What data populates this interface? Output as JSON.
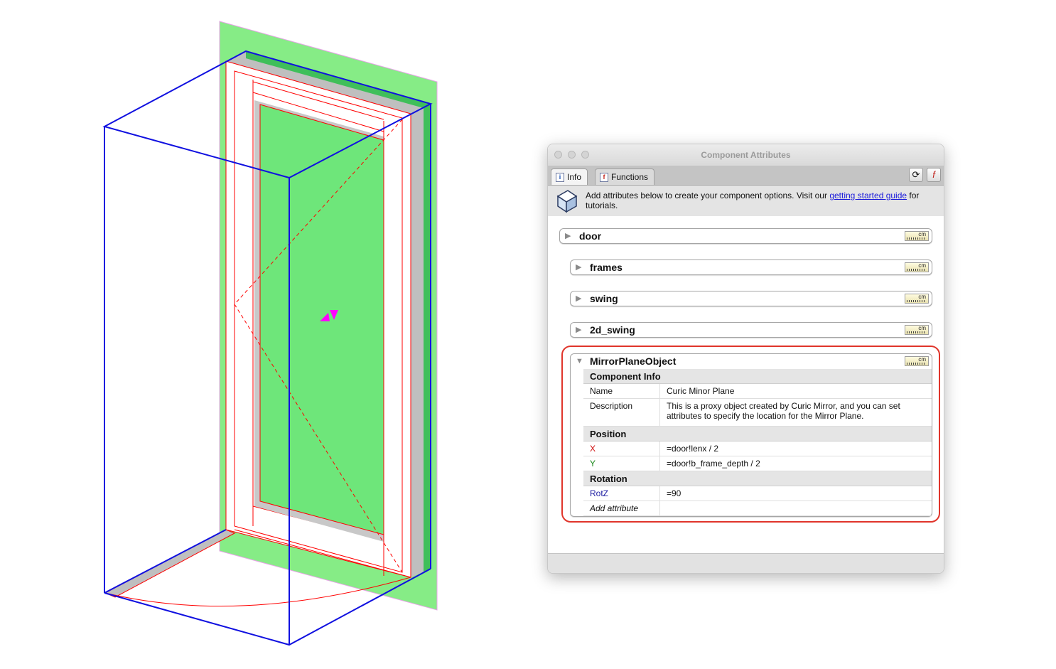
{
  "window": {
    "title": "Component Attributes",
    "tabs": [
      {
        "label": "Info",
        "icon": "info-icon",
        "active": true
      },
      {
        "label": "Functions",
        "icon": "functions-icon",
        "active": false
      }
    ],
    "toolbar": {
      "refresh_icon": "refresh-icon",
      "toggle_formula_icon": "toggle-formula-icon"
    },
    "info": {
      "text_before": "Add attributes below to create your component options. Visit our ",
      "link": "getting started guide",
      "text_after": " for tutorials."
    }
  },
  "components": [
    {
      "name": "door",
      "unit": "cm",
      "expanded": false
    },
    {
      "name": "frames",
      "unit": "cm",
      "expanded": false
    },
    {
      "name": "swing",
      "unit": "cm",
      "expanded": false
    },
    {
      "name": "2d_swing",
      "unit": "cm",
      "expanded": false
    },
    {
      "name": "MirrorPlaneObject",
      "unit": "cm",
      "expanded": true
    }
  ],
  "attributes": {
    "component_info": {
      "header": "Component Info",
      "name_label": "Name",
      "name_value": "Curic Minor Plane",
      "description_label": "Description",
      "description_value": "This is a proxy object created by Curic Mirror, and you can set attributes to specify the location for the Mirror Plane."
    },
    "position": {
      "header": "Position",
      "x_label": "X",
      "x_value": "=door!lenx / 2",
      "y_label": "Y",
      "y_value": "=door!b_frame_depth / 2"
    },
    "rotation": {
      "header": "Rotation",
      "rotz_label": "RotZ",
      "rotz_value": "=90"
    },
    "add_attribute": "Add attribute"
  },
  "colors": {
    "highlight": "#e0352b",
    "mirror_plane": "#6ee86e",
    "bounding_box": "#1010e0",
    "door_lines": "#ff0000",
    "handle_marker": "#ff00ff"
  }
}
